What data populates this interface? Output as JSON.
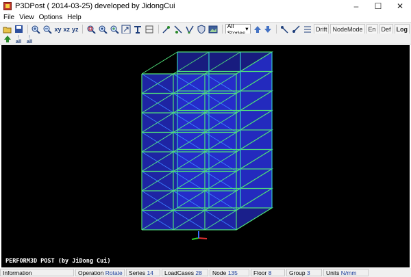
{
  "window": {
    "title": "P3DPost ( 2014-03-25)  developed by JidongCui",
    "minimize": "–",
    "maximize": "☐",
    "close": "✕"
  },
  "menu": [
    "File",
    "View",
    "Options",
    "Help"
  ],
  "toolbar": {
    "xy": "xy",
    "xz": "xz",
    "yz": "yz",
    "stories_value": "All Stories",
    "drift": "Drift",
    "node_mode": "NodeMode",
    "en": "En",
    "def": "Def",
    "log": "Log"
  },
  "toolbar2": {
    "all": "all",
    "all2": "all"
  },
  "viewport": {
    "overlay_text": "PERFORM3D POST (by JiDong Cui)",
    "background": "#000000",
    "frame_color": "#4fe07a",
    "panel_color": "#2b33e8"
  },
  "status": [
    {
      "label": "Information",
      "value": ""
    },
    {
      "label": "Operation",
      "value": "Rotate"
    },
    {
      "label": "Series",
      "value": "14"
    },
    {
      "label": "LoadCases",
      "value": "28"
    },
    {
      "label": "Node",
      "value": "135"
    },
    {
      "label": "Floor",
      "value": "8"
    },
    {
      "label": "Group",
      "value": "3"
    },
    {
      "label": "Units",
      "value": "N/mm"
    }
  ]
}
